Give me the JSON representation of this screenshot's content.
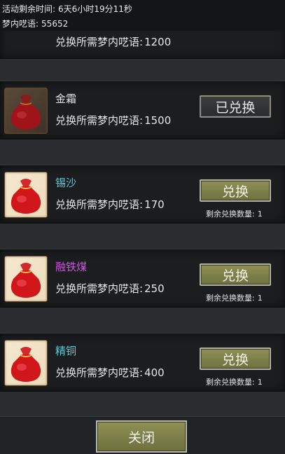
{
  "header": {
    "time_label": "活动剩余时间:",
    "time_value": "6天6小时19分11秒",
    "currency_label": "梦内呓语:",
    "currency_value": "55652"
  },
  "req_label": "兑换所需梦内呓语:",
  "remain_label": "剩余兑换数量:",
  "items": [
    {
      "name": "",
      "cost": "1200",
      "button": "",
      "remain": "",
      "name_color": "#e6e6e6"
    },
    {
      "name": "金霜",
      "cost": "1500",
      "button": "已兑换",
      "remain": "",
      "name_color": "#e6e6e6"
    },
    {
      "name": "锡沙",
      "cost": "170",
      "button": "兑换",
      "remain": "1",
      "name_color": "#5fc8d6"
    },
    {
      "name": "融铁煤",
      "cost": "250",
      "button": "兑换",
      "remain": "1",
      "name_color": "#c65ad6"
    },
    {
      "name": "精铜",
      "cost": "400",
      "button": "兑换",
      "remain": "1",
      "name_color": "#5fc8d6"
    }
  ],
  "close_label": "关闭",
  "icon": "red-pouch-icon"
}
